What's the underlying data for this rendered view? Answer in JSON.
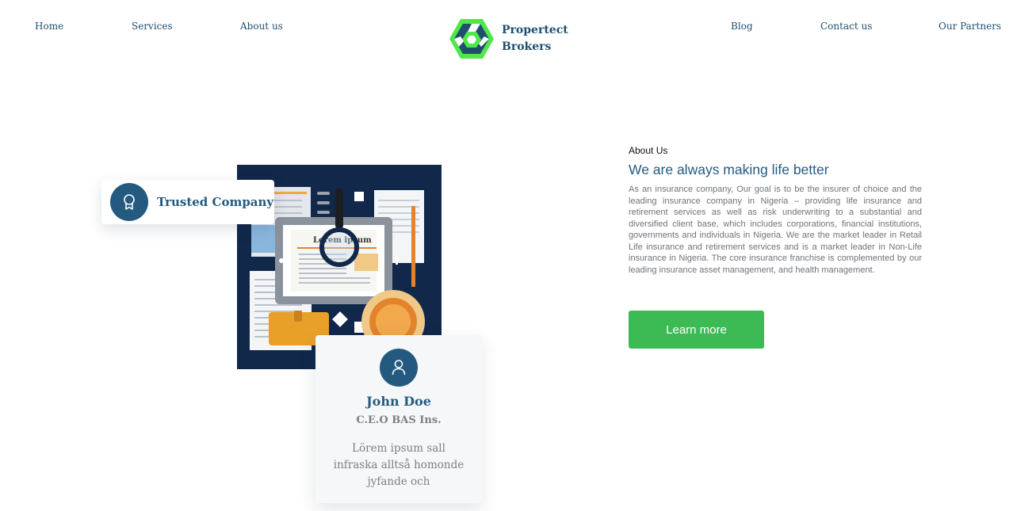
{
  "nav": {
    "home": "Home",
    "services": "Services",
    "about": "About us",
    "blog": "Blog",
    "contact": "Contact us",
    "partners": "Our Partners"
  },
  "logo": {
    "line1": "Propertect",
    "line2": "Brokers",
    "icon": "hexagon-logo-icon"
  },
  "illustration": {
    "paper_title": "Lorem ipsum"
  },
  "trusted_card": {
    "icon": "award-ribbon-icon",
    "label": "Trusted Company"
  },
  "profile_card": {
    "icon": "user-icon",
    "name": "John Doe",
    "role": "C.E.O BAS Ins.",
    "quote": "Lörem ipsum sall infraska alltså homonde jyfande och"
  },
  "about": {
    "label": "About Us",
    "heading": "We are always making life better",
    "body": "As an insurance company, Our goal is to be the insurer of choice and the leading insurance company in Nigeria – providing life insurance and retirement services as well as risk underwriting to a substantial and diversified client base, which includes corporations, financial institutions, governments and individuals in Nigeria. We are the market leader in Retail Life insurance and retirement services and is a market leader in Non-Life insurance in Nigeria. The core insurance franchise is complemented by our leading insurance asset management, and health management.",
    "button_label": "Learn more"
  },
  "colors": {
    "brand_blue": "#245a80",
    "logo_green": "#4ee84a",
    "button_green": "#3cbb55",
    "illustration_bg": "#12284a"
  }
}
